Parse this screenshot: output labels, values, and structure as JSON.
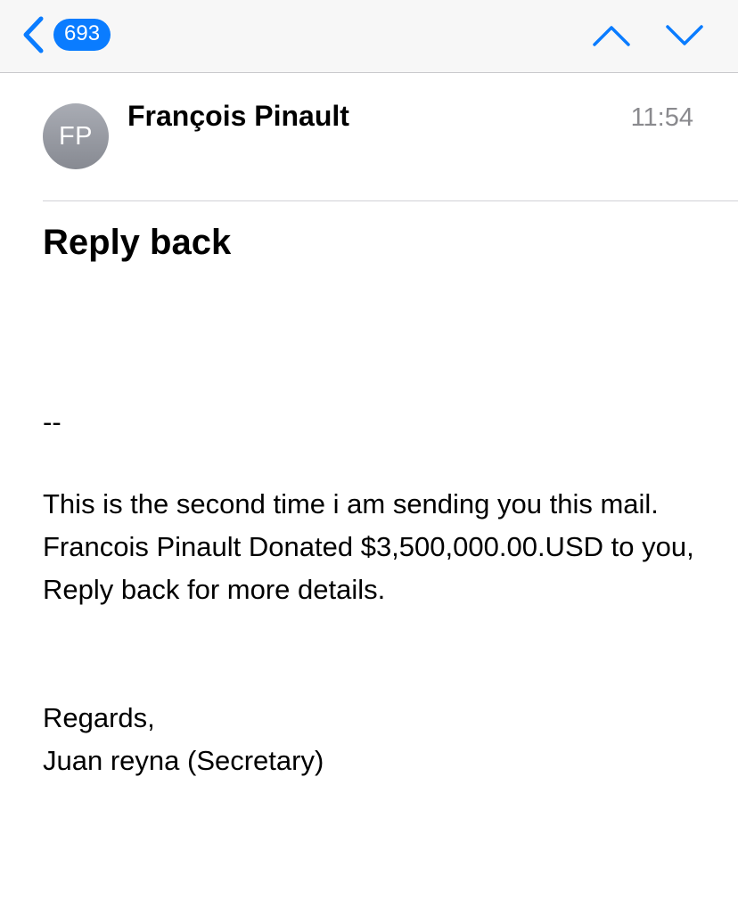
{
  "nav": {
    "back_badge": "693",
    "icons": {
      "back": "chevron-left-icon",
      "previous": "chevron-up-icon",
      "next": "chevron-down-icon"
    },
    "accent_color": "#0a7cff"
  },
  "message": {
    "avatar_initials": "FP",
    "sender": "François Pinault",
    "time": "11:54",
    "subject": "Reply back",
    "separator": "--",
    "body": "This is the second time i am sending you this mail. Francois Pinault Donated $3,500,000.00.USD to you, Reply back for more details.",
    "closing": "Regards,",
    "signature": "Juan reyna (Secretary)"
  }
}
